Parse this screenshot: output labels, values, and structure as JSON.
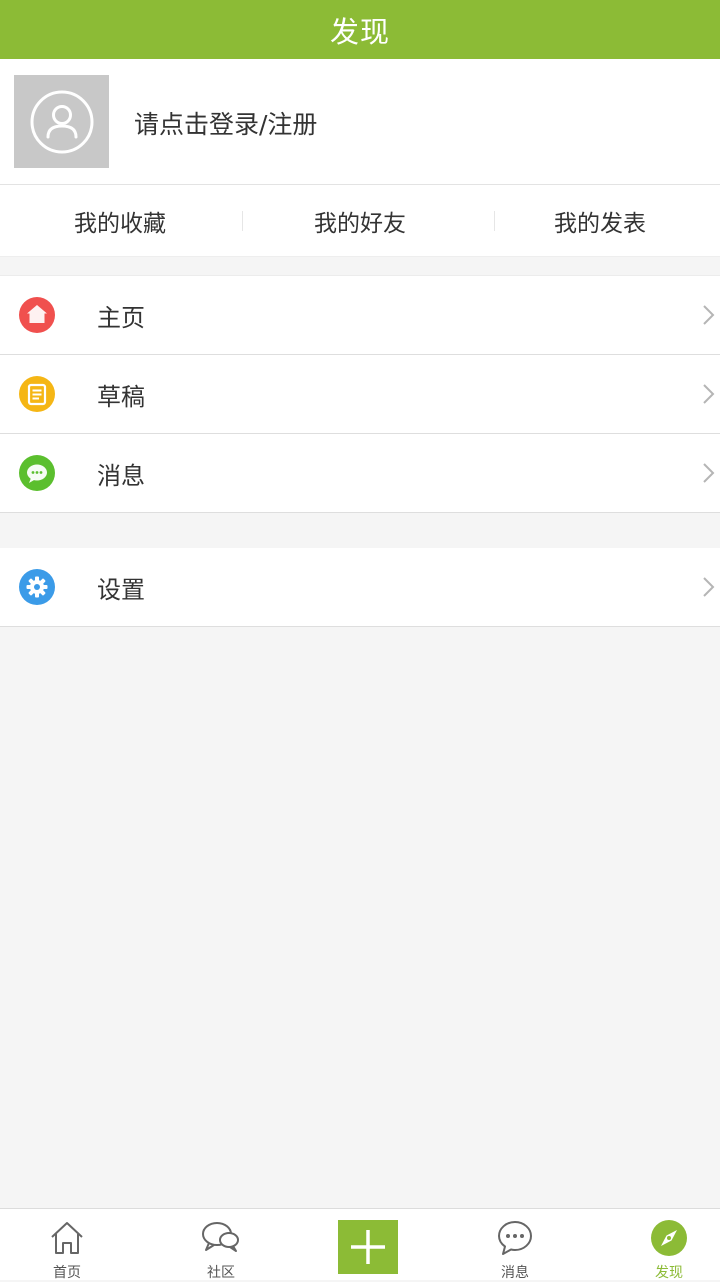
{
  "header": {
    "title": "发现"
  },
  "profile": {
    "login_text": "请点击登录/注册"
  },
  "quick_links": [
    {
      "label": "我的收藏"
    },
    {
      "label": "我的好友"
    },
    {
      "label": "我的发表"
    }
  ],
  "menu": {
    "items": [
      {
        "label": "主页",
        "icon": "home-icon",
        "color": "#f0504e"
      },
      {
        "label": "草稿",
        "icon": "draft-icon",
        "color": "#f5b615"
      },
      {
        "label": "消息",
        "icon": "message-icon",
        "color": "#5bbf2e"
      }
    ],
    "settings": {
      "label": "设置",
      "icon": "gear-icon",
      "color": "#3b9be8"
    }
  },
  "tabbar": {
    "items": [
      {
        "label": "首页",
        "icon": "home-outline-icon"
      },
      {
        "label": "社区",
        "icon": "chat-bubbles-icon"
      },
      {
        "label": "",
        "icon": "plus-icon"
      },
      {
        "label": "消息",
        "icon": "message-outline-icon"
      },
      {
        "label": "发现",
        "icon": "compass-icon",
        "active": true
      }
    ]
  },
  "colors": {
    "brand_green": "#8cbb36",
    "background": "#f5f5f5"
  }
}
